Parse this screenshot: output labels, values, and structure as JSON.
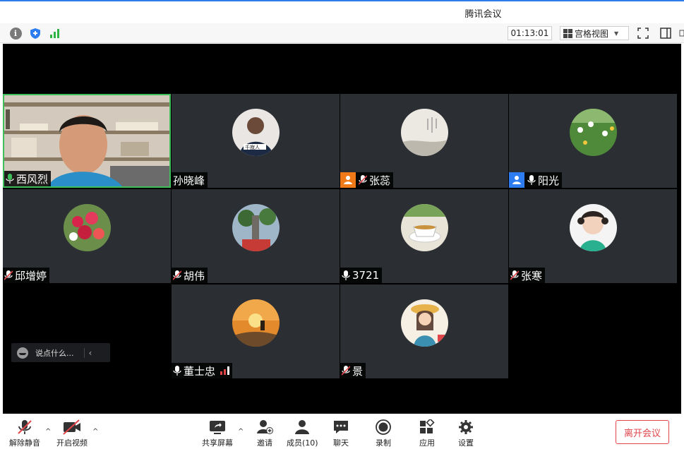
{
  "window": {
    "title": "腾讯会议"
  },
  "toolbar": {
    "icons": [
      "info-icon",
      "shield-icon",
      "signal-icon",
      "fullscreen-icon",
      "sidebar-toggle-icon"
    ],
    "timer": "01:13:01",
    "view_label": "宫格视图"
  },
  "participants": [
    {
      "name": "西风烈",
      "mic": "on",
      "active": true
    },
    {
      "name": "孙晓峰",
      "mic": "none",
      "avatar": "hand-drawn-icon"
    },
    {
      "name": "张蕊",
      "mic": "muted",
      "badge": "orange-user-icon"
    },
    {
      "name": "阳光",
      "mic": "on",
      "badge": "blue-user-icon"
    },
    {
      "name": "邱增婷",
      "mic": "muted"
    },
    {
      "name": "胡伟",
      "mic": "muted"
    },
    {
      "name": "3721",
      "mic": "on"
    },
    {
      "name": "张寒",
      "mic": "muted"
    },
    {
      "name": "董士忠",
      "mic": "on",
      "speaking": true
    },
    {
      "name": "景",
      "mic": "muted"
    }
  ],
  "chat": {
    "placeholder": "说点什么..."
  },
  "bottombar": {
    "unmute": "解除静音",
    "start_video": "开启视频",
    "share_screen": "共享屏幕",
    "invite": "邀请",
    "members": "成员(10)",
    "chat": "聊天",
    "record": "录制",
    "apps": "应用",
    "settings": "设置",
    "leave": "离开会议"
  },
  "colors": {
    "accent": "#2b7de9",
    "active_border": "#3fbf5a",
    "leave": "#e0454a",
    "tile_bg": "#2b2e33"
  }
}
